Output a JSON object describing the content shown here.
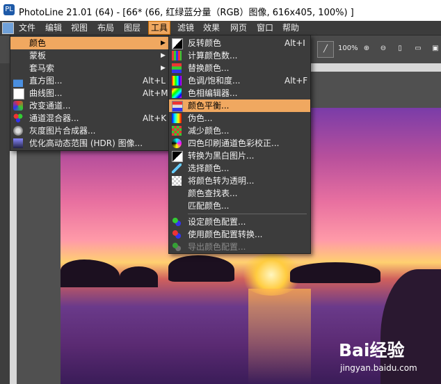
{
  "window": {
    "title": "PhotoLine 21.01 (64) - [66* (66, 红绿蓝分量（RGB）图像, 616x405, 100%) ]"
  },
  "menubar": {
    "items": [
      "文件",
      "编辑",
      "视图",
      "布局",
      "图层",
      "工具",
      "滤镜",
      "效果",
      "网页",
      "窗口",
      "帮助"
    ],
    "active": "工具"
  },
  "toolbar": {
    "zoom_label": "100%"
  },
  "menu_tools": [
    {
      "label": "颜色",
      "shortcut": "",
      "submenu": true,
      "highlighted": true,
      "icon": "blank"
    },
    {
      "label": "蒙板",
      "shortcut": "",
      "submenu": true,
      "icon": "blank"
    },
    {
      "label": "套马索",
      "shortcut": "",
      "submenu": true,
      "icon": "blank"
    },
    {
      "label": "直方图...",
      "shortcut": "Alt+L",
      "icon": "histogram-icon"
    },
    {
      "label": "曲线图...",
      "shortcut": "Alt+M",
      "icon": "curves-icon"
    },
    {
      "label": "改变通道...",
      "shortcut": "",
      "icon": "channels-icon"
    },
    {
      "label": "通道混合器...",
      "shortcut": "Alt+K",
      "icon": "channel-mixer-icon"
    },
    {
      "label": "灰度图片合成器...",
      "shortcut": "",
      "icon": "grayscale-mixer-icon"
    },
    {
      "label": "优化高动态范围 (HDR) 图像...",
      "shortcut": "",
      "icon": "hdr-icon"
    }
  ],
  "menu_color": [
    {
      "label": "反转颜色",
      "shortcut": "Alt+I",
      "icon": "invert-icon"
    },
    {
      "label": "计算颜色数...",
      "shortcut": "",
      "icon": "count-colors-icon"
    },
    {
      "label": "替换颜色...",
      "shortcut": "",
      "icon": "replace-color-icon"
    },
    {
      "label": "色调/饱和度...",
      "shortcut": "Alt+F",
      "icon": "hue-saturation-icon"
    },
    {
      "label": "色相编辑器...",
      "shortcut": "",
      "icon": "hue-editor-icon"
    },
    {
      "label": "颜色平衡...",
      "shortcut": "",
      "icon": "color-balance-icon",
      "highlighted": true
    },
    {
      "label": "伪色...",
      "shortcut": "",
      "icon": "pseudo-color-icon"
    },
    {
      "label": "减少颜色...",
      "shortcut": "",
      "icon": "reduce-colors-icon"
    },
    {
      "label": "四色印刷通道色彩校正...",
      "shortcut": "",
      "icon": "cmyk-correction-icon"
    },
    {
      "label": "转换为黑白图片...",
      "shortcut": "",
      "icon": "black-white-icon"
    },
    {
      "label": "选择颜色...",
      "shortcut": "",
      "icon": "eyedropper-icon"
    },
    {
      "label": "将颜色转为透明...",
      "shortcut": "",
      "icon": "color-to-alpha-icon"
    },
    {
      "label": "颜色查找表...",
      "shortcut": "",
      "icon": "lookup-table-icon"
    },
    {
      "label": "匹配颜色...",
      "shortcut": "",
      "icon": "match-color-icon"
    },
    {
      "separator": true
    },
    {
      "label": "设定颜色配置...",
      "shortcut": "",
      "icon": "color-profile-icon"
    },
    {
      "label": "使用颜色配置转换...",
      "shortcut": "",
      "icon": "convert-profile-icon"
    },
    {
      "label": "导出颜色配置...",
      "shortcut": "",
      "icon": "export-profile-icon",
      "disabled": true
    }
  ],
  "watermark": {
    "brand": "Bai经验",
    "url": "jingyan.baidu.com"
  },
  "colors": {
    "menu_bg": "#3c3c3c",
    "highlight": "#f0a860",
    "text": "#f0f0f0",
    "disabled": "#8a8a8a"
  }
}
